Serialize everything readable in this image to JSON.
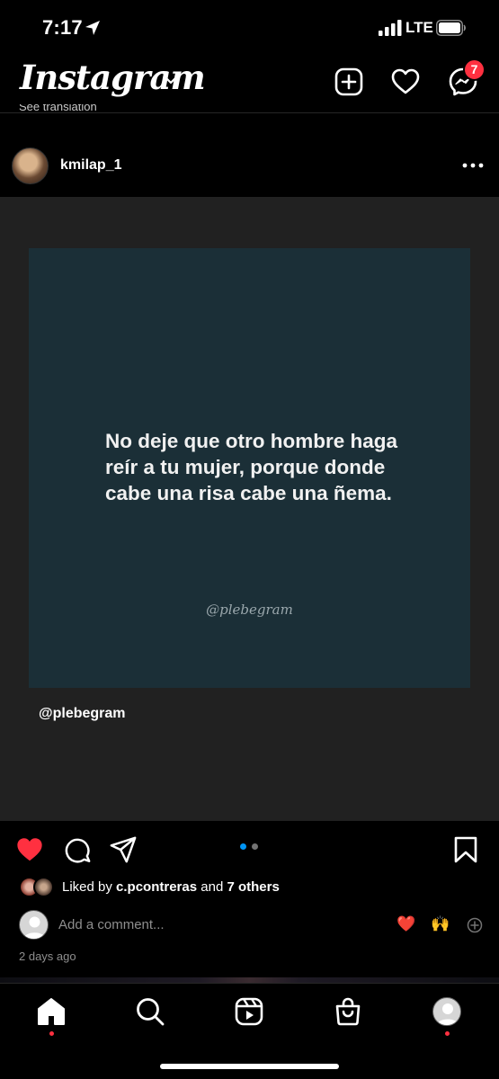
{
  "status_bar": {
    "time": "7:17",
    "network": "LTE"
  },
  "header": {
    "app_name": "Instagram",
    "messages_badge": "7",
    "truncated_text": "See translation"
  },
  "post": {
    "username": "kmilap_1",
    "quote": "No deje que otro hombre haga reír a tu mujer, porque donde cabe una risa cabe una ñema.",
    "quote_signature": "@plebegram",
    "media_credit": "@plebegram",
    "carousel": {
      "total": 2,
      "current": 1
    },
    "liked": true,
    "likes": {
      "prefix": "Liked by ",
      "user": "c.pcontreras",
      "middle": " and ",
      "others": "7 others"
    },
    "comment_placeholder": "Add a comment...",
    "quick_reactions": [
      "❤️",
      "🙌"
    ],
    "timestamp": "2 days ago"
  },
  "nav": {
    "items": [
      "home-icon",
      "search-icon",
      "reels-icon",
      "shop-icon",
      "profile-avatar"
    ],
    "active": "home"
  },
  "colors": {
    "background": "#000000",
    "media_background": "#212121",
    "quote_card": "#1b2f37",
    "accent_blue": "#0095f6",
    "like_red": "#ff3040"
  }
}
